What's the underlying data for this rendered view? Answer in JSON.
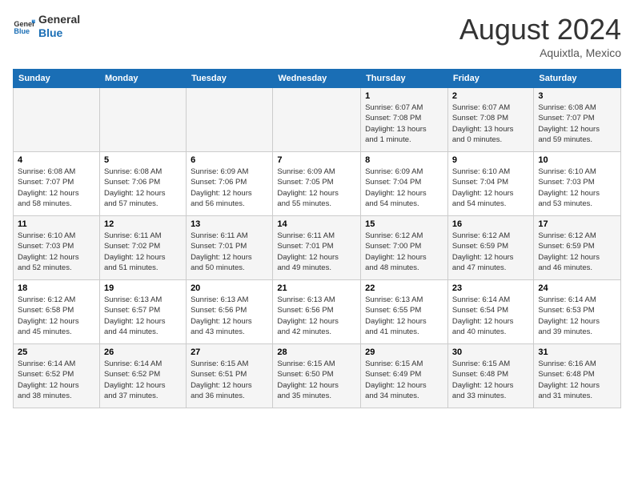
{
  "header": {
    "logo_line1": "General",
    "logo_line2": "Blue",
    "month_year": "August 2024",
    "location": "Aquixtla, Mexico"
  },
  "weekdays": [
    "Sunday",
    "Monday",
    "Tuesday",
    "Wednesday",
    "Thursday",
    "Friday",
    "Saturday"
  ],
  "weeks": [
    [
      {
        "day": "",
        "info": ""
      },
      {
        "day": "",
        "info": ""
      },
      {
        "day": "",
        "info": ""
      },
      {
        "day": "",
        "info": ""
      },
      {
        "day": "1",
        "info": "Sunrise: 6:07 AM\nSunset: 7:08 PM\nDaylight: 13 hours\nand 1 minute."
      },
      {
        "day": "2",
        "info": "Sunrise: 6:07 AM\nSunset: 7:08 PM\nDaylight: 13 hours\nand 0 minutes."
      },
      {
        "day": "3",
        "info": "Sunrise: 6:08 AM\nSunset: 7:07 PM\nDaylight: 12 hours\nand 59 minutes."
      }
    ],
    [
      {
        "day": "4",
        "info": "Sunrise: 6:08 AM\nSunset: 7:07 PM\nDaylight: 12 hours\nand 58 minutes."
      },
      {
        "day": "5",
        "info": "Sunrise: 6:08 AM\nSunset: 7:06 PM\nDaylight: 12 hours\nand 57 minutes."
      },
      {
        "day": "6",
        "info": "Sunrise: 6:09 AM\nSunset: 7:06 PM\nDaylight: 12 hours\nand 56 minutes."
      },
      {
        "day": "7",
        "info": "Sunrise: 6:09 AM\nSunset: 7:05 PM\nDaylight: 12 hours\nand 55 minutes."
      },
      {
        "day": "8",
        "info": "Sunrise: 6:09 AM\nSunset: 7:04 PM\nDaylight: 12 hours\nand 54 minutes."
      },
      {
        "day": "9",
        "info": "Sunrise: 6:10 AM\nSunset: 7:04 PM\nDaylight: 12 hours\nand 54 minutes."
      },
      {
        "day": "10",
        "info": "Sunrise: 6:10 AM\nSunset: 7:03 PM\nDaylight: 12 hours\nand 53 minutes."
      }
    ],
    [
      {
        "day": "11",
        "info": "Sunrise: 6:10 AM\nSunset: 7:03 PM\nDaylight: 12 hours\nand 52 minutes."
      },
      {
        "day": "12",
        "info": "Sunrise: 6:11 AM\nSunset: 7:02 PM\nDaylight: 12 hours\nand 51 minutes."
      },
      {
        "day": "13",
        "info": "Sunrise: 6:11 AM\nSunset: 7:01 PM\nDaylight: 12 hours\nand 50 minutes."
      },
      {
        "day": "14",
        "info": "Sunrise: 6:11 AM\nSunset: 7:01 PM\nDaylight: 12 hours\nand 49 minutes."
      },
      {
        "day": "15",
        "info": "Sunrise: 6:12 AM\nSunset: 7:00 PM\nDaylight: 12 hours\nand 48 minutes."
      },
      {
        "day": "16",
        "info": "Sunrise: 6:12 AM\nSunset: 6:59 PM\nDaylight: 12 hours\nand 47 minutes."
      },
      {
        "day": "17",
        "info": "Sunrise: 6:12 AM\nSunset: 6:59 PM\nDaylight: 12 hours\nand 46 minutes."
      }
    ],
    [
      {
        "day": "18",
        "info": "Sunrise: 6:12 AM\nSunset: 6:58 PM\nDaylight: 12 hours\nand 45 minutes."
      },
      {
        "day": "19",
        "info": "Sunrise: 6:13 AM\nSunset: 6:57 PM\nDaylight: 12 hours\nand 44 minutes."
      },
      {
        "day": "20",
        "info": "Sunrise: 6:13 AM\nSunset: 6:56 PM\nDaylight: 12 hours\nand 43 minutes."
      },
      {
        "day": "21",
        "info": "Sunrise: 6:13 AM\nSunset: 6:56 PM\nDaylight: 12 hours\nand 42 minutes."
      },
      {
        "day": "22",
        "info": "Sunrise: 6:13 AM\nSunset: 6:55 PM\nDaylight: 12 hours\nand 41 minutes."
      },
      {
        "day": "23",
        "info": "Sunrise: 6:14 AM\nSunset: 6:54 PM\nDaylight: 12 hours\nand 40 minutes."
      },
      {
        "day": "24",
        "info": "Sunrise: 6:14 AM\nSunset: 6:53 PM\nDaylight: 12 hours\nand 39 minutes."
      }
    ],
    [
      {
        "day": "25",
        "info": "Sunrise: 6:14 AM\nSunset: 6:52 PM\nDaylight: 12 hours\nand 38 minutes."
      },
      {
        "day": "26",
        "info": "Sunrise: 6:14 AM\nSunset: 6:52 PM\nDaylight: 12 hours\nand 37 minutes."
      },
      {
        "day": "27",
        "info": "Sunrise: 6:15 AM\nSunset: 6:51 PM\nDaylight: 12 hours\nand 36 minutes."
      },
      {
        "day": "28",
        "info": "Sunrise: 6:15 AM\nSunset: 6:50 PM\nDaylight: 12 hours\nand 35 minutes."
      },
      {
        "day": "29",
        "info": "Sunrise: 6:15 AM\nSunset: 6:49 PM\nDaylight: 12 hours\nand 34 minutes."
      },
      {
        "day": "30",
        "info": "Sunrise: 6:15 AM\nSunset: 6:48 PM\nDaylight: 12 hours\nand 33 minutes."
      },
      {
        "day": "31",
        "info": "Sunrise: 6:16 AM\nSunset: 6:48 PM\nDaylight: 12 hours\nand 31 minutes."
      }
    ]
  ]
}
